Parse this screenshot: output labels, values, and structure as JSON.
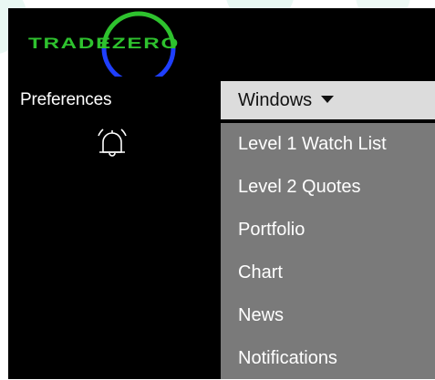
{
  "colors": {
    "app_background": "#000000",
    "logo_green": "#2ec22e",
    "logo_blue": "#1f3fff",
    "menu_header_bg": "#dcdcdc",
    "menu_list_bg": "#7a7a7a",
    "watermark": "#e9f8f3"
  },
  "logo": {
    "text": "TRADEZERO",
    "icon": "tradezero-logo-icon"
  },
  "preferences": {
    "label": "Preferences",
    "icon": "bell-icon"
  },
  "windows_menu": {
    "label": "Windows",
    "icon": "caret-down-icon",
    "items": [
      {
        "label": "Level 1 Watch List"
      },
      {
        "label": "Level 2 Quotes"
      },
      {
        "label": "Portfolio"
      },
      {
        "label": "Chart"
      },
      {
        "label": "News"
      },
      {
        "label": "Notifications"
      }
    ]
  }
}
